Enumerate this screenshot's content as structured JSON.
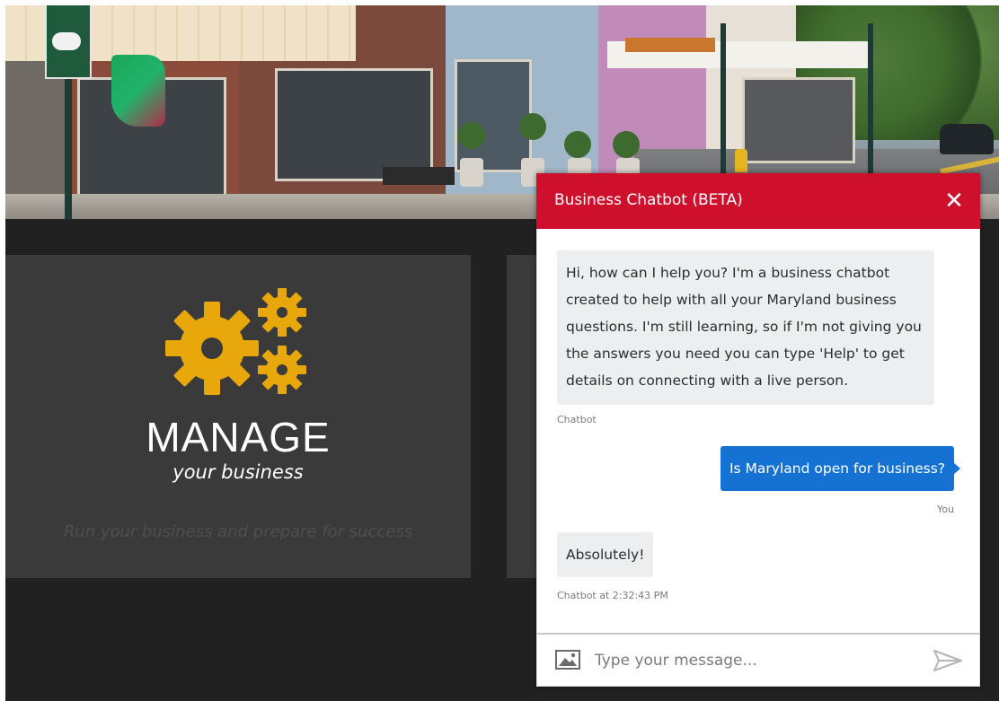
{
  "card": {
    "title": "MANAGE",
    "subtitle": "your business",
    "tagline": "Run your business and prepare for success"
  },
  "chat": {
    "header_title": "Business Chatbot (BETA)",
    "close_symbol": "✕",
    "messages": [
      {
        "sender": "bot",
        "text": "Hi, how can I help you? I'm a business chatbot created to help with all your Maryland business questions. I'm still learning, so if I'm not giving you the answers you need you can type 'Help' to get details on connecting with a live person.",
        "meta": "Chatbot"
      },
      {
        "sender": "user",
        "text": "Is Maryland open for business?",
        "meta": "You"
      },
      {
        "sender": "bot",
        "text": "Absolutely!",
        "meta": "Chatbot at 2:32:43 PM"
      }
    ],
    "input_placeholder": "Type your message..."
  },
  "icons": {
    "close": "close-icon",
    "image_upload": "image-icon",
    "send": "send-icon",
    "gears": "gears-icon"
  },
  "colors": {
    "header_red": "#cf102d",
    "user_bubble_blue": "#1572d3",
    "bot_bubble_gray": "#eceeef",
    "gear_gold": "#e8a80c",
    "page_dark": "#212121",
    "card_gray": "#3a3a3a"
  }
}
